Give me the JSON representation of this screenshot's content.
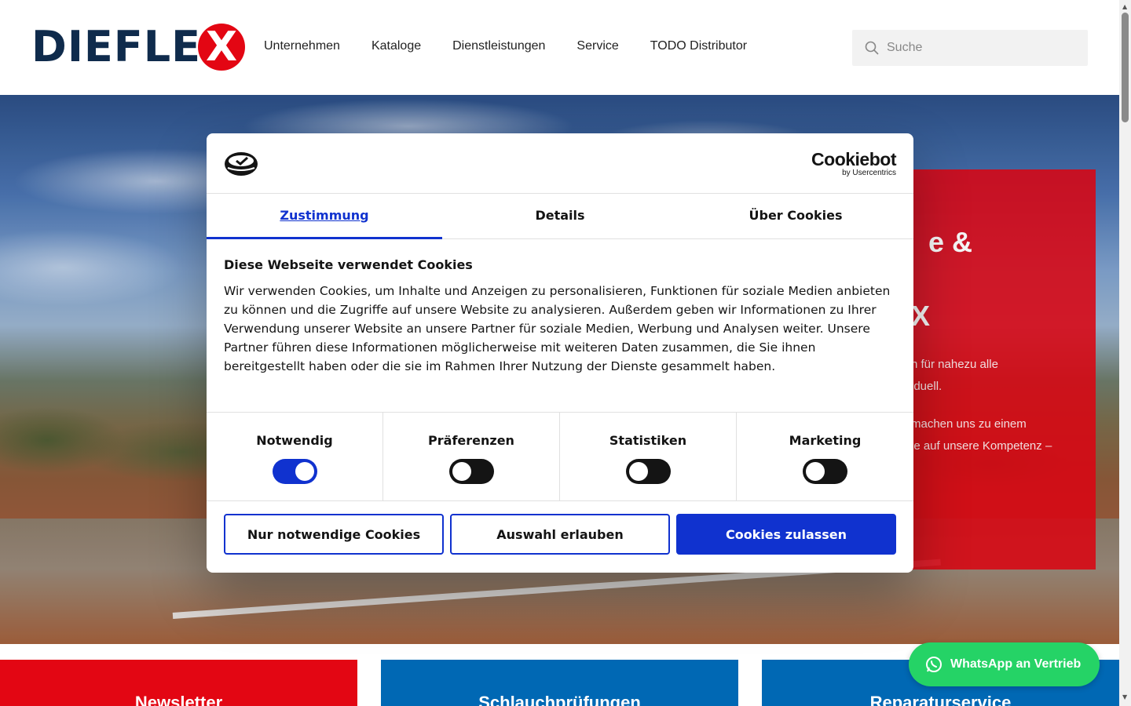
{
  "header": {
    "logo_text": "DIEFLE",
    "logo_x": "X",
    "nav": [
      "Unternehmen",
      "Kataloge",
      "Dienstleistungen",
      "Service",
      "TODO Distributor"
    ],
    "search_placeholder": "Suche"
  },
  "hero": {
    "card_title_line1": "e &",
    "card_title_line2": "X",
    "card_text": [
      "n für nahezu alle",
      "iduell.",
      "machen uns zu einem",
      "ie auf unsere Kompetenz –"
    ]
  },
  "cookie_dialog": {
    "brand": "Cookiebot",
    "brand_sub": "by Usercentrics",
    "tabs": [
      "Zustimmung",
      "Details",
      "Über Cookies"
    ],
    "title": "Diese Webseite verwendet Cookies",
    "text": "Wir verwenden Cookies, um Inhalte und Anzeigen zu personalisieren, Funktionen für soziale Medien anbieten zu können und die Zugriffe auf unsere Website zu analysieren. Außerdem geben wir Informationen zu Ihrer Verwendung unserer Website an unsere Partner für soziale Medien, Werbung und Analysen weiter. Unsere Partner führen diese Informationen möglicherweise mit weiteren Daten zusammen, die Sie ihnen bereitgestellt haben oder die sie im Rahmen Ihrer Nutzung der Dienste gesammelt haben.",
    "toggles": [
      {
        "label": "Notwendig",
        "on": true
      },
      {
        "label": "Präferenzen",
        "on": false
      },
      {
        "label": "Statistiken",
        "on": false
      },
      {
        "label": "Marketing",
        "on": false
      }
    ],
    "buttons": {
      "necessary": "Nur notwendige Cookies",
      "selection": "Auswahl erlauben",
      "accept_all": "Cookies zulassen"
    }
  },
  "tiles": [
    "Newsletter",
    "Schlauchprüfungen",
    "Reparaturservice"
  ],
  "whatsapp_label": "WhatsApp an Vertrieb",
  "colors": {
    "brand_red": "#e30613",
    "brand_navy": "#0f2b4c",
    "cookiebot_blue": "#1032cf",
    "tile_blue": "#0068b4",
    "whatsapp_green": "#25d366"
  }
}
